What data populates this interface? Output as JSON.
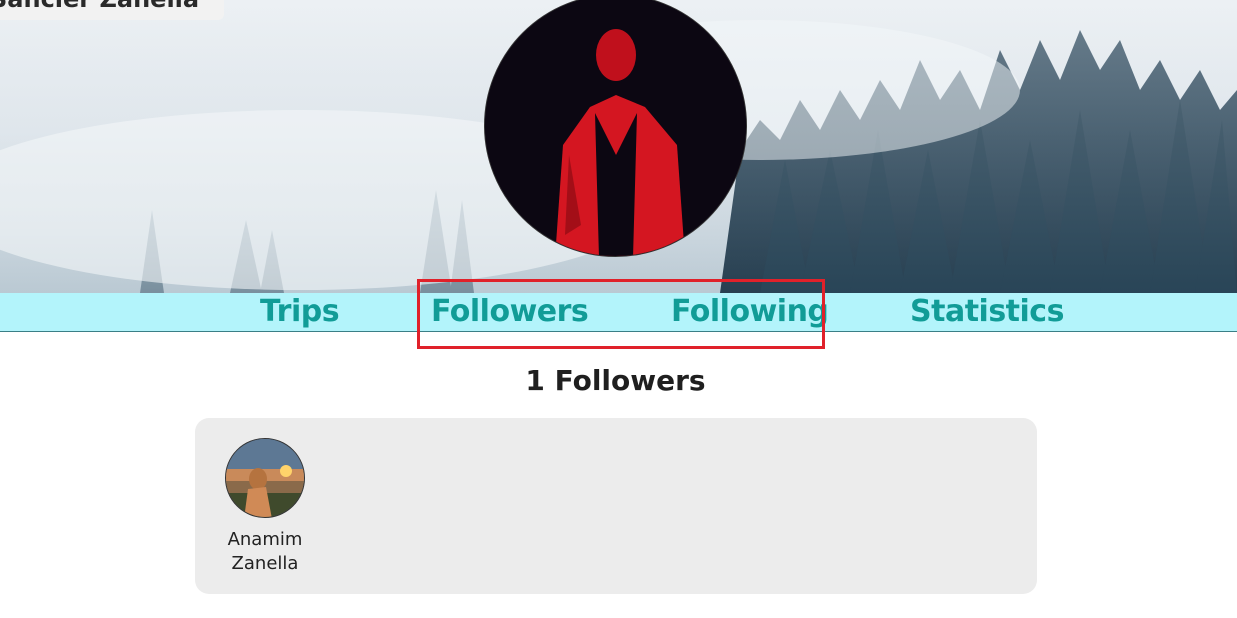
{
  "profile": {
    "name": "Sancler Zanella"
  },
  "tabs": {
    "trips": "Trips",
    "followers": "Followers",
    "following": "Following",
    "statistics": "Statistics"
  },
  "followers_section": {
    "heading": "1 Followers",
    "items": [
      {
        "first_name": "Anamim",
        "last_name": "Zanella"
      }
    ]
  },
  "colors": {
    "tab_bar_bg": "#b3f4fb",
    "tab_text": "#119c97",
    "highlight_border": "#e0212a",
    "panel_bg": "#ececec"
  },
  "icons": {
    "banner": "foggy-forest-image",
    "profile_avatar": "profile-photo",
    "follower_avatar": "sunset-photo"
  }
}
